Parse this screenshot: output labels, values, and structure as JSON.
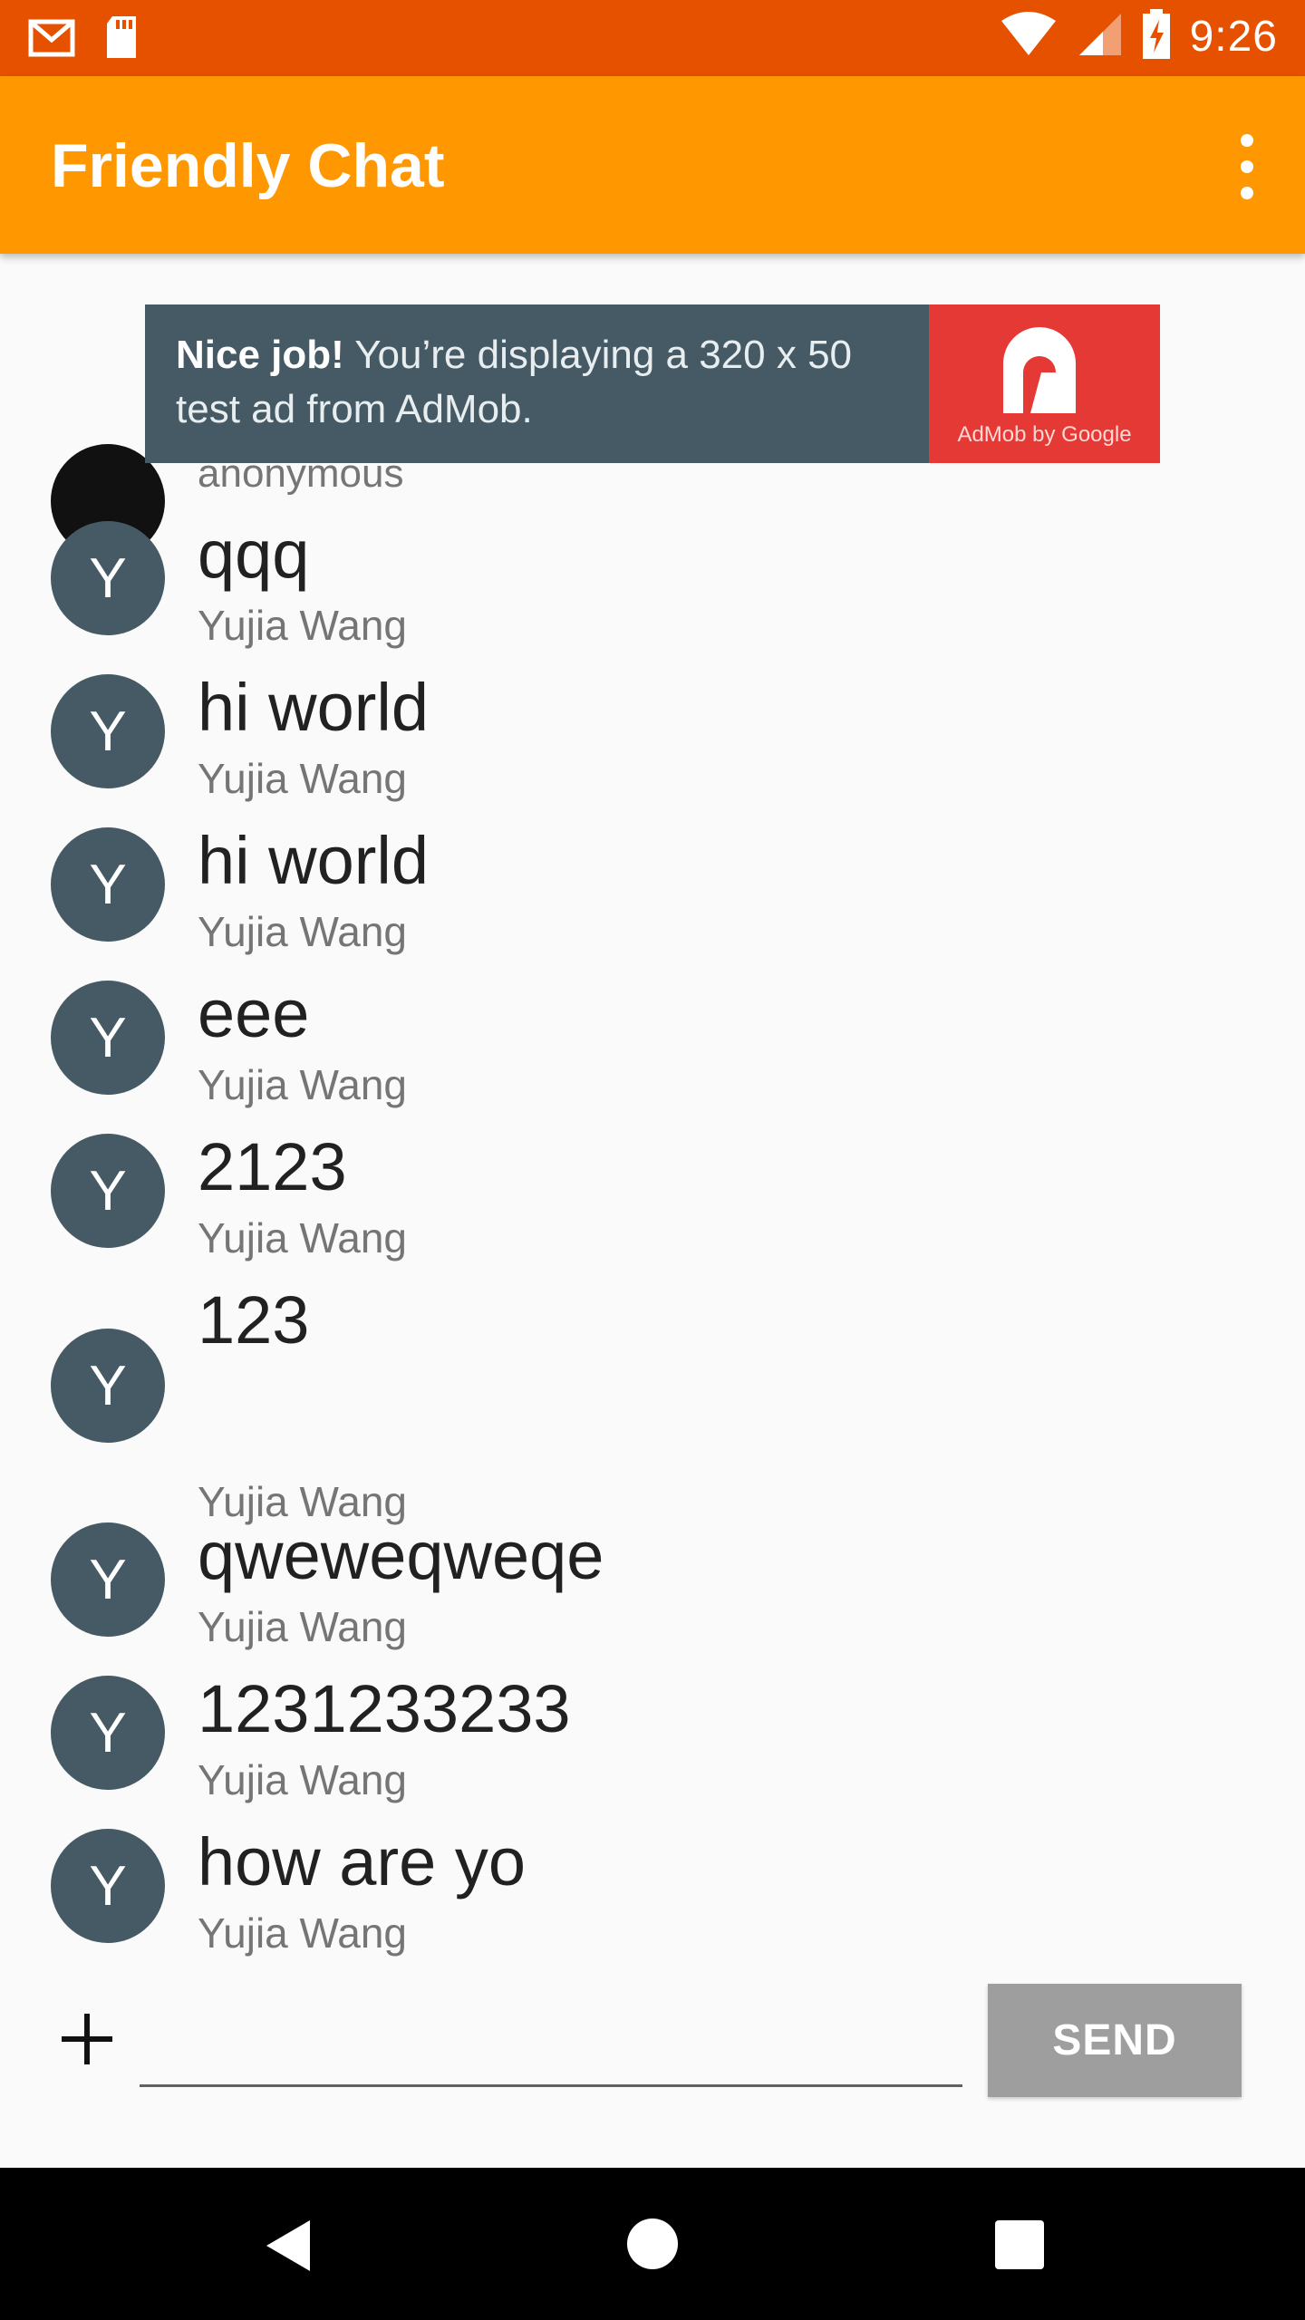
{
  "status_bar": {
    "time": "9:26",
    "icons": [
      "gmail-icon",
      "sd-card-icon",
      "wifi-icon",
      "cell-signal-icon",
      "battery-charging-icon"
    ]
  },
  "app_bar": {
    "title": "Friendly Chat",
    "menu_icon": "overflow-menu-icon"
  },
  "ad": {
    "headline": "Nice job!",
    "body_line1": "You’re displaying a 320 x 50",
    "body_line2": "test ad from AdMob.",
    "brand": "AdMob by Google"
  },
  "partial_message": {
    "name": "anonymous"
  },
  "messages": [
    {
      "initial": "Y",
      "text": "qqq",
      "name": "Yujia Wang"
    },
    {
      "initial": "Y",
      "text": "hi world",
      "name": "Yujia Wang"
    },
    {
      "initial": "Y",
      "text": "hi world",
      "name": "Yujia Wang"
    },
    {
      "initial": "Y",
      "text": "eee",
      "name": "Yujia Wang"
    },
    {
      "initial": "Y",
      "text": "2123",
      "name": "Yujia Wang"
    },
    {
      "initial": "Y",
      "text": "123",
      "name": "Yujia Wang"
    },
    {
      "initial": "Y",
      "text": "qweweqweqe",
      "name": "Yujia Wang"
    },
    {
      "initial": "Y",
      "text": "1231233233",
      "name": "Yujia Wang"
    },
    {
      "initial": "Y",
      "text": "how are yo",
      "name": "Yujia Wang"
    }
  ],
  "composer": {
    "input_value": "",
    "send_label": "SEND"
  }
}
